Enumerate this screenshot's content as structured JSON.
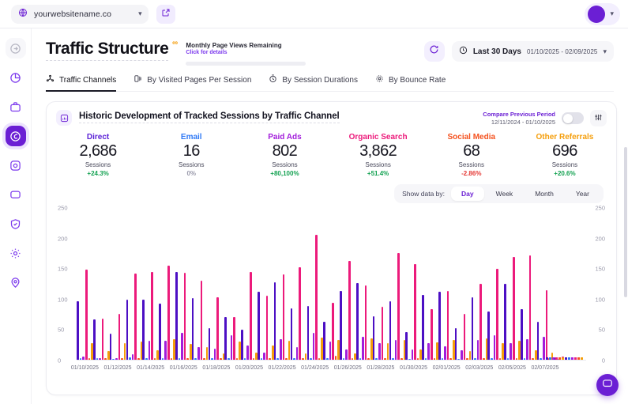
{
  "browser": {
    "site": "yourwebsitename.co",
    "site_icon": "globe-icon",
    "dropdown_icon": "chevron-down-icon",
    "external_icon": "external-link-icon",
    "avatar_icon": "user-avatar"
  },
  "rail": {
    "items": [
      {
        "name": "dashboard-icon",
        "state": "muted"
      },
      {
        "name": "analytics-pie-icon",
        "state": "normal"
      },
      {
        "name": "briefcase-icon",
        "state": "normal"
      },
      {
        "name": "traffic-icon",
        "state": "active"
      },
      {
        "name": "target-icon",
        "state": "normal"
      },
      {
        "name": "chat-icon",
        "state": "normal"
      },
      {
        "name": "shield-icon",
        "state": "normal"
      },
      {
        "name": "gear-icon",
        "state": "normal"
      },
      {
        "name": "location-icon",
        "state": "normal"
      }
    ]
  },
  "header": {
    "title": "Traffic Structure",
    "quota_title": "Monthly Page Views Remaining",
    "quota_link": "Click for details",
    "quota_infinity": "∞",
    "refresh_icon": "refresh-icon",
    "date_icon": "clock-icon",
    "date_label": "Last 30 Days",
    "date_range": "01/10/2025 - 02/09/2025",
    "date_chevron": "chevron-down-icon"
  },
  "tabs": [
    {
      "label": "Traffic Channels",
      "icon": "share-nodes-icon",
      "active": true
    },
    {
      "label": "By Visited Pages Per Session",
      "icon": "pages-icon",
      "active": false
    },
    {
      "label": "By Session Durations",
      "icon": "stopwatch-icon",
      "active": false
    },
    {
      "label": "By Bounce Rate",
      "icon": "bounce-icon",
      "active": false
    }
  ],
  "card": {
    "icon": "bar-chart-icon",
    "title": "Historic Development of Tracked Sessions by Traffic Channel",
    "compare_label": "Compare Previous Period",
    "compare_range": "12/11/2024 - 01/10/2025",
    "compare_enabled": false,
    "settings_icon": "sliders-icon"
  },
  "kpis": [
    {
      "name": "Direct",
      "value": "2,686",
      "unit": "Sessions",
      "delta": "+24.3%",
      "delta_dir": "up",
      "color": "#5b21d6"
    },
    {
      "name": "Email",
      "value": "16",
      "unit": "Sessions",
      "delta": "0%",
      "delta_dir": "flat",
      "color": "#2f79f5"
    },
    {
      "name": "Paid Ads",
      "value": "802",
      "unit": "Sessions",
      "delta": "+80,100%",
      "delta_dir": "up",
      "color": "#a21ddb"
    },
    {
      "name": "Organic Search",
      "value": "3,862",
      "unit": "Sessions",
      "delta": "+51.4%",
      "delta_dir": "up",
      "color": "#ec1a7b"
    },
    {
      "name": "Social Media",
      "value": "68",
      "unit": "Sessions",
      "delta": "-2.86%",
      "delta_dir": "down",
      "color": "#f4511e"
    },
    {
      "name": "Other Referrals",
      "value": "696",
      "unit": "Sessions",
      "delta": "+20.6%",
      "delta_dir": "up",
      "color": "#f59e0b"
    }
  ],
  "granularity": {
    "label": "Show data by:",
    "options": [
      "Day",
      "Week",
      "Month",
      "Year"
    ],
    "selected": "Day"
  },
  "colors": {
    "accent": "#6b1fd4",
    "positive": "#12a150",
    "negative": "#e53935",
    "neutral": "#9a9aab"
  },
  "chart_data": {
    "type": "bar",
    "title": "Historic Development of Tracked Sessions by Traffic Channel",
    "xlabel": "",
    "ylabel": "",
    "ylim": [
      0,
      250
    ],
    "yticks": [
      0,
      50,
      100,
      150,
      200,
      250
    ],
    "grid": false,
    "legend_position": "top",
    "dual_axis": true,
    "x": [
      "01/10/2025",
      "01/11/2025",
      "01/12/2025",
      "01/13/2025",
      "01/14/2025",
      "01/15/2025",
      "01/16/2025",
      "01/17/2025",
      "01/18/2025",
      "01/19/2025",
      "01/20/2025",
      "01/21/2025",
      "01/22/2025",
      "01/23/2025",
      "01/24/2025",
      "01/25/2025",
      "01/26/2025",
      "01/27/2025",
      "01/28/2025",
      "01/29/2025",
      "01/30/2025",
      "01/31/2025",
      "02/01/2025",
      "02/02/2025",
      "02/03/2025",
      "02/04/2025",
      "02/05/2025",
      "02/06/2025",
      "02/07/2025",
      "02/08/2025",
      "02/09/2025"
    ],
    "xtick_labels": [
      "01/10/2025",
      "01/12/2025",
      "01/14/2025",
      "01/16/2025",
      "01/18/2025",
      "01/20/2025",
      "01/22/2025",
      "01/24/2025",
      "01/26/2025",
      "01/28/2025",
      "01/30/2025",
      "02/01/2025",
      "02/03/2025",
      "02/05/2025",
      "02/07/2025"
    ],
    "xtick_indices": [
      0,
      2,
      4,
      6,
      8,
      10,
      12,
      14,
      16,
      18,
      20,
      22,
      24,
      26,
      28
    ],
    "series": [
      {
        "name": "Direct",
        "color": "#4c0fc4",
        "values": [
          97,
          67,
          43,
          99,
          99,
          92,
          145,
          102,
          52,
          70,
          50,
          112,
          128,
          85,
          89,
          62,
          113,
          126,
          72,
          97,
          46,
          107,
          112,
          52,
          103,
          79,
          125,
          84,
          62,
          4,
          0
        ]
      },
      {
        "name": "Email",
        "color": "#2f79f5",
        "values": [
          3,
          2,
          1,
          4,
          3,
          2,
          3,
          2,
          2,
          2,
          2,
          3,
          2,
          2,
          2,
          2,
          3,
          2,
          2,
          2,
          1,
          2,
          2,
          1,
          2,
          2,
          3,
          2,
          2,
          1,
          0
        ]
      },
      {
        "name": "Paid Ads",
        "color": "#a21ddb",
        "values": [
          5,
          3,
          2,
          9,
          31,
          31,
          44,
          21,
          18,
          41,
          23,
          12,
          34,
          21,
          44,
          30,
          17,
          38,
          28,
          33,
          17,
          27,
          22,
          15,
          33,
          40,
          28,
          34,
          38,
          2,
          0
        ]
      },
      {
        "name": "Organic Search",
        "color": "#ec1a7b",
        "values": [
          148,
          68,
          76,
          142,
          144,
          155,
          143,
          130,
          103,
          70,
          145,
          105,
          140,
          153,
          206,
          94,
          163,
          123,
          87,
          176,
          158,
          83,
          113,
          76,
          125,
          150,
          169,
          172,
          115,
          5,
          0
        ]
      },
      {
        "name": "Social Media",
        "color": "#f4511e",
        "values": [
          3,
          2,
          2,
          3,
          2,
          3,
          3,
          2,
          2,
          3,
          2,
          2,
          3,
          2,
          3,
          6,
          2,
          3,
          2,
          3,
          2,
          2,
          3,
          2,
          2,
          2,
          3,
          2,
          2,
          1,
          0
        ]
      },
      {
        "name": "Other Referrals",
        "color": "#f59e0b",
        "values": [
          27,
          14,
          27,
          30,
          16,
          34,
          26,
          21,
          10,
          30,
          12,
          24,
          31,
          10,
          37,
          33,
          11,
          35,
          27,
          33,
          17,
          29,
          32,
          14,
          35,
          27,
          31,
          16,
          12,
          2,
          0
        ]
      }
    ]
  },
  "fab": {
    "icon": "chat-bubble-icon"
  }
}
